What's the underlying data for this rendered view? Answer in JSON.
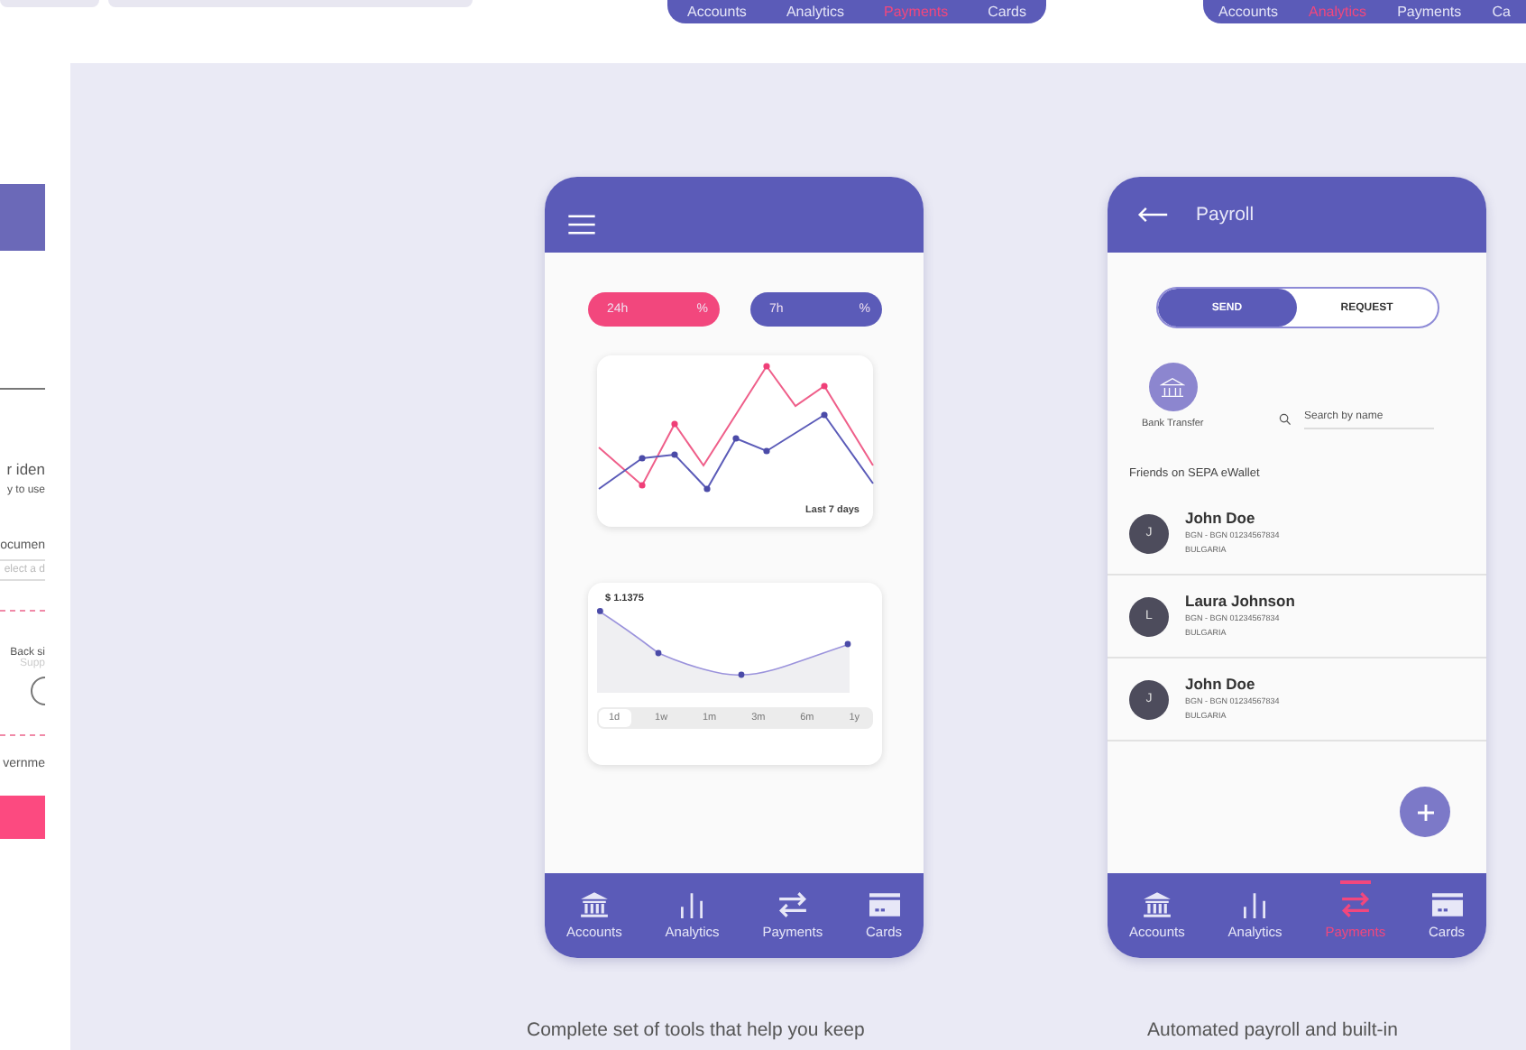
{
  "top_strip": {
    "tab_bars": [
      {
        "items": [
          {
            "label": "Accounts",
            "selected": false
          },
          {
            "label": "Analytics",
            "selected": false
          },
          {
            "label": "Payments",
            "selected": true
          },
          {
            "label": "Cards",
            "selected": false
          }
        ]
      },
      {
        "items": [
          {
            "label": "Accounts",
            "selected": false
          },
          {
            "label": "Analytics",
            "selected": true
          },
          {
            "label": "Payments",
            "selected": false
          },
          {
            "label": "Ca",
            "selected": false
          }
        ]
      }
    ]
  },
  "left_panel": {
    "heading_fragment": "r iden",
    "subtitle_fragment": "y to use",
    "field_label_fragment": "ocumen",
    "field_placeholder_fragment": "elect a d",
    "upload_label_fragment": "Back si",
    "upload_hint_fragment": "Supp",
    "option_fragment": "vernme"
  },
  "analytics_phone": {
    "pills": [
      {
        "label": "24h",
        "unit": "%",
        "color": "#f2477d"
      },
      {
        "label": "7h",
        "unit": "%",
        "color": "#5b5bb8"
      }
    ],
    "trend_card": {
      "caption": "Last 7 days"
    },
    "price_card": {
      "value": "$ 1.1375",
      "ranges": [
        {
          "label": "1d",
          "selected": true
        },
        {
          "label": "1w",
          "selected": false
        },
        {
          "label": "1m",
          "selected": false
        },
        {
          "label": "3m",
          "selected": false
        },
        {
          "label": "6m",
          "selected": false
        },
        {
          "label": "1y",
          "selected": false
        }
      ]
    },
    "nav": [
      {
        "label": "Accounts",
        "kind": "bank",
        "selected": false
      },
      {
        "label": "Analytics",
        "kind": "bars",
        "selected": false
      },
      {
        "label": "Payments",
        "kind": "arrows",
        "selected": false
      },
      {
        "label": "Cards",
        "kind": "card",
        "selected": false
      }
    ]
  },
  "payroll_phone": {
    "title": "Payroll",
    "toggle": [
      {
        "label": "SEND",
        "selected": true
      },
      {
        "label": "REQUEST",
        "selected": false
      }
    ],
    "bank_transfer": {
      "label": "Bank Transfer"
    },
    "search": {
      "placeholder": "Search by name"
    },
    "section_title": "Friends on SEPA eWallet",
    "contacts": [
      {
        "initial": "J",
        "name": "John Doe",
        "account": "BGN - BGN 01234567834",
        "country": "BULGARIA"
      },
      {
        "initial": "L",
        "name": "Laura Johnson",
        "account": "BGN - BGN 01234567834",
        "country": "BULGARIA"
      },
      {
        "initial": "J",
        "name": "John Doe",
        "account": "BGN - BGN 01234567834",
        "country": "BULGARIA"
      }
    ],
    "nav": [
      {
        "label": "Accounts",
        "kind": "bank",
        "selected": false
      },
      {
        "label": "Analytics",
        "kind": "bars",
        "selected": false
      },
      {
        "label": "Payments",
        "kind": "arrows",
        "selected": true
      },
      {
        "label": "Cards",
        "kind": "card",
        "selected": false
      }
    ]
  },
  "captions": [
    "Complete set of tools that help you keep",
    "Automated payroll and built-in"
  ]
}
